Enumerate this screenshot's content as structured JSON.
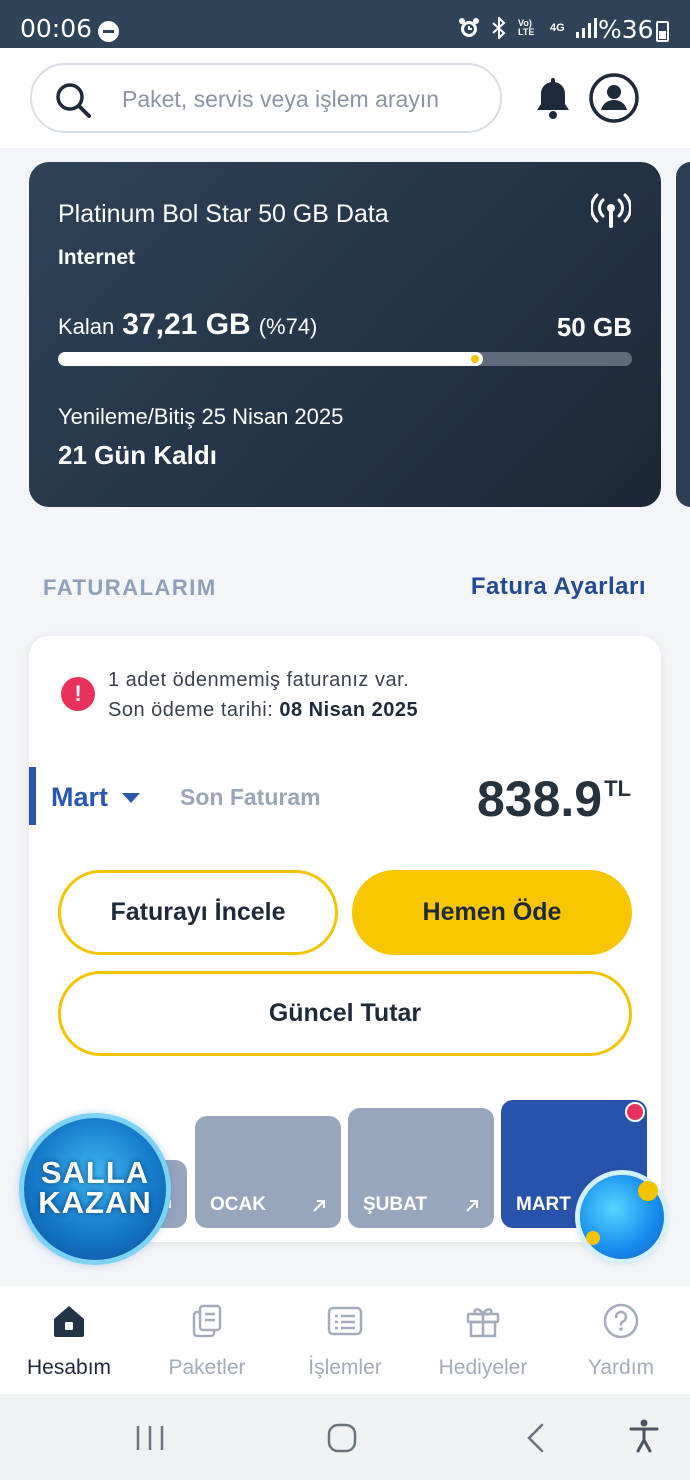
{
  "status_bar": {
    "time": "00:06",
    "battery": "%36",
    "network": "4G",
    "volte": "Vo) LTE"
  },
  "search": {
    "placeholder": "Paket, servis veya işlem arayın"
  },
  "package": {
    "title": "Platinum Bol Star 50 GB Data",
    "type": "Internet",
    "remaining_label": "Kalan",
    "remaining_value": "37,21 GB",
    "remaining_percent": "(%74)",
    "remaining_fraction": 0.74,
    "total": "50 GB",
    "renewal": "Yenileme/Bitiş 25 Nisan 2025",
    "days_left": "21 Gün Kaldı"
  },
  "bills": {
    "section_title": "FATURALARIM",
    "settings_link": "Fatura Ayarları",
    "alert_line1": "1 adet ödenmemiş faturanız var.",
    "alert_due_label": "Son ödeme tarihi:",
    "alert_due_date": "08 Nisan 2025",
    "selected_month": "Mart",
    "last_bill_label": "Son Faturam",
    "amount": "838.9",
    "currency": "TL",
    "review_button": "Faturayı İncele",
    "pay_button": "Hemen Öde",
    "current_button": "Güncel Tutar",
    "months": [
      "",
      "OCAK",
      "ŞUBAT",
      "MART"
    ]
  },
  "badges": {
    "salla_line1": "SALLA",
    "salla_line2": "KAZAN"
  },
  "bottom_nav": [
    {
      "label": "Hesabım",
      "icon": "home-icon"
    },
    {
      "label": "Paketler",
      "icon": "packages-icon"
    },
    {
      "label": "İşlemler",
      "icon": "list-icon"
    },
    {
      "label": "Hediyeler",
      "icon": "gift-icon"
    },
    {
      "label": "Yardım",
      "icon": "help-icon"
    }
  ],
  "colors": {
    "brand_navy": "#243447",
    "accent_yellow": "#f8c600",
    "accent_blue": "#2a57b2",
    "alert_red": "#e8315b"
  }
}
